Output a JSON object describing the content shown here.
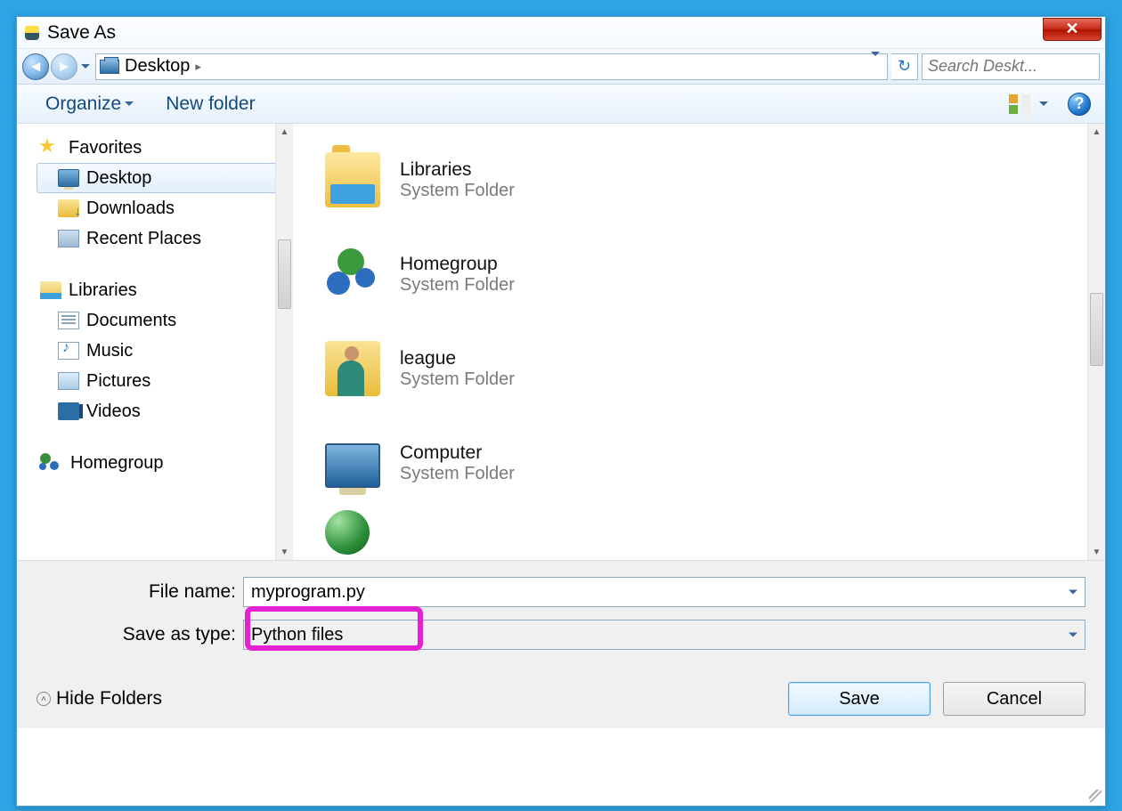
{
  "title": "Save As",
  "breadcrumb": {
    "location": "Desktop"
  },
  "search": {
    "placeholder": "Search Deskt..."
  },
  "toolbar": {
    "organize": "Organize",
    "newFolder": "New folder"
  },
  "sidebar": {
    "favoritesHeader": "Favorites",
    "favorites": [
      {
        "label": "Desktop",
        "icon": "monitor",
        "selected": true
      },
      {
        "label": "Downloads",
        "icon": "folder-dl"
      },
      {
        "label": "Recent Places",
        "icon": "docstack"
      }
    ],
    "librariesHeader": "Libraries",
    "libraries": [
      {
        "label": "Documents",
        "icon": "doc"
      },
      {
        "label": "Music",
        "icon": "music"
      },
      {
        "label": "Pictures",
        "icon": "pic"
      },
      {
        "label": "Videos",
        "icon": "video"
      }
    ],
    "homegroup": "Homegroup"
  },
  "content": {
    "items": [
      {
        "title": "Libraries",
        "sub": "System Folder",
        "icon": "lib"
      },
      {
        "title": "Homegroup",
        "sub": "System Folder",
        "icon": "hg"
      },
      {
        "title": "league",
        "sub": "System Folder",
        "icon": "user"
      },
      {
        "title": "Computer",
        "sub": "System Folder",
        "icon": "computer"
      }
    ]
  },
  "form": {
    "fileNameLabel": "File name:",
    "fileNameValue": "myprogram.py",
    "saveTypeLabel": "Save as type:",
    "saveTypeValue": "Python files"
  },
  "footer": {
    "hideFolders": "Hide Folders",
    "save": "Save",
    "cancel": "Cancel"
  }
}
